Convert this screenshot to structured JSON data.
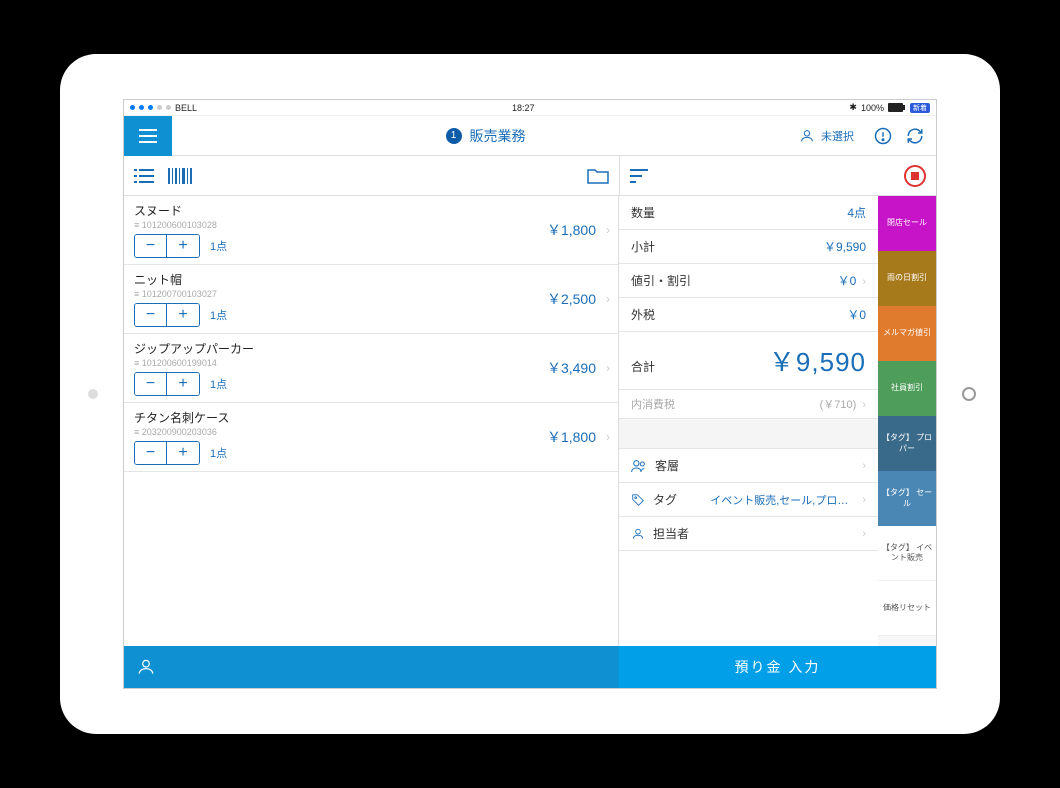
{
  "status": {
    "carrier": "BELL",
    "time": "18:27",
    "battery": "100%",
    "badge": "新着"
  },
  "nav": {
    "step": "1",
    "title": "販売業務",
    "customer": "未選択"
  },
  "items": [
    {
      "name": "スヌード",
      "code": "101200600103028",
      "qty": "1点",
      "price": "￥1,800"
    },
    {
      "name": "ニット帽",
      "code": "101200700103027",
      "qty": "1点",
      "price": "￥2,500"
    },
    {
      "name": "ジップアップパーカー",
      "code": "101200600199014",
      "qty": "1点",
      "price": "￥3,490"
    },
    {
      "name": "チタン名刺ケース",
      "code": "203200900203036",
      "qty": "1点",
      "price": "￥1,800"
    }
  ],
  "summary": {
    "qty_label": "数量",
    "qty": "4点",
    "subtotal_label": "小計",
    "subtotal": "￥9,590",
    "discount_label": "値引・割引",
    "discount": "￥0",
    "outtax_label": "外税",
    "outtax": "￥0",
    "total_label": "合計",
    "total": "￥9,590",
    "intax_label": "内消費税",
    "intax": "(￥710)",
    "segment_label": "客層",
    "tag_label": "タグ",
    "tag_value": "イベント販売,セール,プロ…",
    "staff_label": "担当者"
  },
  "side": [
    {
      "label": "閉店セール",
      "color": "#c814c8"
    },
    {
      "label": "雨の日割引",
      "color": "#a67a1a"
    },
    {
      "label": "メルマガ値引",
      "color": "#e07b2e"
    },
    {
      "label": "社員割引",
      "color": "#4f9d5b"
    },
    {
      "label": "【タグ】\nプロパー",
      "color": "#3a6a8a"
    },
    {
      "label": "【タグ】\nセール",
      "color": "#4a87b5"
    },
    {
      "label": "【タグ】\nイベント販売",
      "color": "#ffffff"
    },
    {
      "label": "価格リセット",
      "color": "#ffffff"
    }
  ],
  "footer": {
    "checkout": "預り金 入力"
  }
}
